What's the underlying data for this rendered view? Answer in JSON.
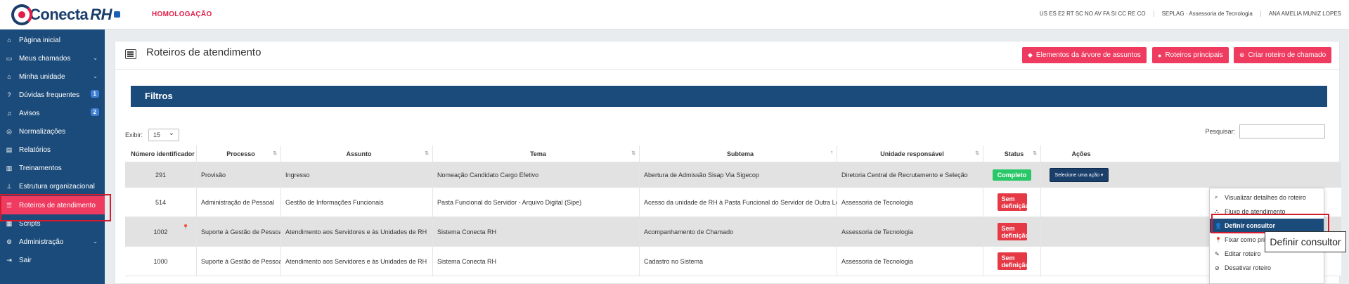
{
  "header": {
    "logo_main": "Conecta",
    "logo_rh": "RH",
    "environment": "HOMOLOGAÇÃO",
    "user_links": [
      "US ES E2 RT SC NO AV FA SI CC RE CO",
      "SEPLAG · Assessoria de Tecnologia",
      "ANA AMELIA MUNIZ LOPES"
    ]
  },
  "sidebar": {
    "items": [
      {
        "label": "Página inicial",
        "icon": "home-icon"
      },
      {
        "label": "Meus chamados",
        "icon": "inbox-icon",
        "chevron": "⌄"
      },
      {
        "label": "Minha unidade",
        "icon": "building-icon",
        "chevron": "⌄"
      },
      {
        "label": "Dúvidas frequentes",
        "icon": "question-icon",
        "badge": "1"
      },
      {
        "label": "Avisos",
        "icon": "bell-icon",
        "badge": "2"
      },
      {
        "label": "Normalizações",
        "icon": "compass-icon"
      },
      {
        "label": "Relatórios",
        "icon": "file-icon"
      },
      {
        "label": "Treinamentos",
        "icon": "book-icon"
      },
      {
        "label": "Estrutura organizacional",
        "icon": "sitemap-icon"
      },
      {
        "label": "Roteiros de atendimento",
        "icon": "list-icon"
      },
      {
        "label": "Scripts",
        "icon": "script-icon"
      },
      {
        "label": "Administração",
        "icon": "cogs-icon",
        "chevron": "⌄"
      },
      {
        "label": "Sair",
        "icon": "logout-icon"
      }
    ]
  },
  "page": {
    "title": "Roteiros de atendimento",
    "buttons": {
      "elements": "Elementos da árvore de assuntos",
      "main": "Roteiros principais",
      "create": "Criar roteiro de chamado"
    },
    "filters_title": "Filtros",
    "show_label": "Exibir:",
    "show_value": "15",
    "search_label": "Pesquisar:",
    "search_value": ""
  },
  "table": {
    "headers": [
      "Número identificador",
      "Processo",
      "Assunto",
      "Tema",
      "Subtema",
      "Unidade responsável",
      "Status",
      "Ações"
    ],
    "rows": [
      {
        "id": "291",
        "processo": "Provisão",
        "assunto": "Ingresso",
        "tema": "Nomeação Candidato Cargo Efetivo",
        "subtema": "Abertura de Admissão Sisap Via Sigecop",
        "unidade": "Diretoria Central de Recrutamento e Seleção",
        "status": "Completo",
        "action": "Selecione uma ação"
      },
      {
        "id": "514",
        "processo": "Administração de Pessoal",
        "assunto": "Gestão de Informações Funcionais",
        "tema": "Pasta Funcional do Servidor - Arquivo Digital (Sipe)",
        "subtema": "Acesso da unidade de RH à Pasta Funcional do Servidor de Outra Lotação",
        "unidade": "Assessoria de Tecnologia",
        "status": "Sem definição",
        "action": ""
      },
      {
        "id": "1002",
        "processo": "Suporte à Gestão de Pessoas",
        "assunto": "Atendimento aos Servidores e às Unidades de RH",
        "tema": "Sistema Conecta RH",
        "subtema": "Acompanhamento de Chamado",
        "unidade": "Assessoria de Tecnologia",
        "status": "Sem definição",
        "action": ""
      },
      {
        "id": "1000",
        "processo": "Suporte à Gestão de Pessoas",
        "assunto": "Atendimento aos Servidores e às Unidades de RH",
        "tema": "Sistema Conecta RH",
        "subtema": "Cadastro no Sistema",
        "unidade": "Assessoria de Tecnologia",
        "status": "Sem definição",
        "action": ""
      }
    ]
  },
  "dropdown": {
    "items": [
      {
        "label": "Visualizar detalhes do roteiro",
        "icon": "search-icon",
        "glyph": "⌕"
      },
      {
        "label": "Fluxo de atendimento",
        "icon": "flow-icon",
        "glyph": "⛬"
      },
      {
        "label": "Definir consultor",
        "icon": "user-icon",
        "glyph": "👤"
      },
      {
        "label": "Fixar como principal",
        "icon": "pin-icon",
        "glyph": "📍"
      },
      {
        "label": "Editar roteiro",
        "icon": "pencil-icon",
        "glyph": "✎"
      },
      {
        "label": "Desativar roteiro",
        "icon": "ban-icon",
        "glyph": "⊘"
      }
    ]
  },
  "tooltip": "Definir consultor"
}
